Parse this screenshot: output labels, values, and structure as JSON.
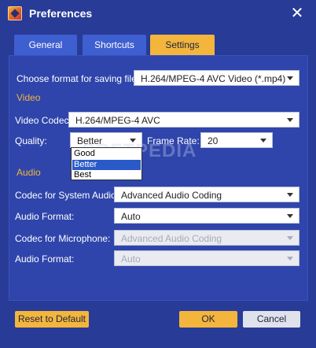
{
  "window": {
    "title": "Preferences"
  },
  "tabs": [
    {
      "label": "General"
    },
    {
      "label": "Shortcuts"
    },
    {
      "label": "Settings",
      "active": true
    }
  ],
  "settings": {
    "save_format_label": "Choose format for saving file:",
    "save_format_value": "H.264/MPEG-4 AVC Video (*.mp4)",
    "video_section": "Video",
    "video_codec_label": "Video Codec:",
    "video_codec_value": "H.264/MPEG-4 AVC",
    "quality_label": "Quality:",
    "quality_value": "Better",
    "quality_options": [
      "Good",
      "Better",
      "Best"
    ],
    "quality_selected_option": "Better",
    "frame_rate_label": "Frame Rate:",
    "frame_rate_value": "20",
    "audio_section": "Audio",
    "system_audio_codec_label": "Codec for System Audio:",
    "system_audio_codec_value": "Advanced Audio Coding",
    "system_audio_format_label": "Audio Format:",
    "system_audio_format_value": "Auto",
    "mic_codec_label": "Codec for Microphone:",
    "mic_codec_value": "Advanced Audio Coding",
    "mic_format_label": "Audio Format:",
    "mic_format_value": "Auto"
  },
  "buttons": {
    "reset": "Reset to Default",
    "ok": "OK",
    "cancel": "Cancel"
  },
  "watermark": "SOFTPEDIA",
  "colors": {
    "background": "#283b97",
    "panel": "#2f45ab",
    "tab_inactive": "#3e5fd0",
    "accent": "#f3b53c",
    "selection": "#2a5ac9"
  }
}
